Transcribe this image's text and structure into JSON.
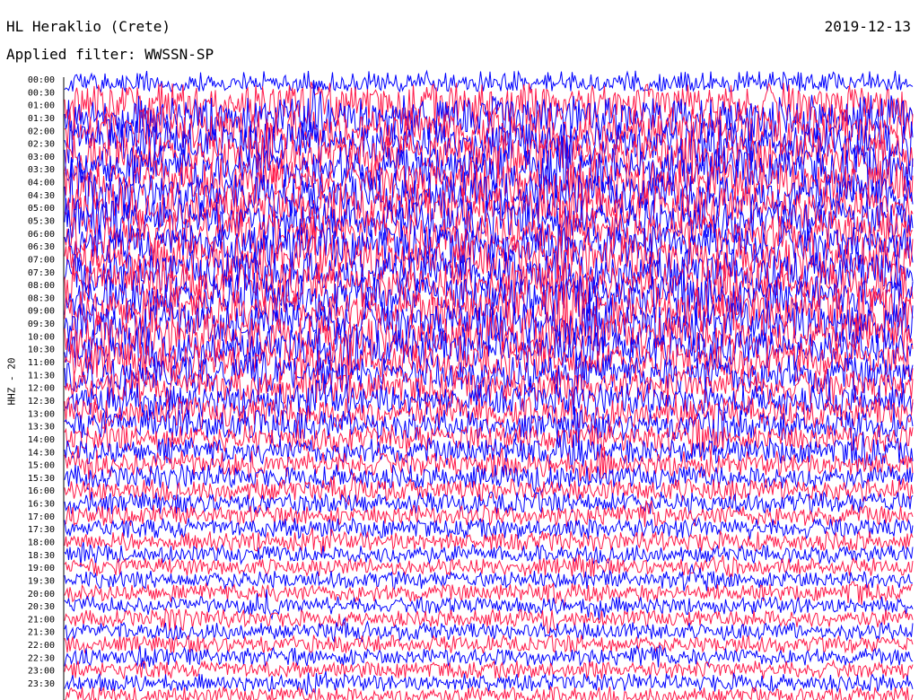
{
  "header": {
    "station": "HL Heraklio (Crete)",
    "date": "2019-12-13",
    "filter_label": "Applied filter: WWSSN-SP"
  },
  "chart_data": {
    "type": "helicorder",
    "channel_label": "HHZ - 20",
    "line_labels": [
      "00:00",
      "00:30",
      "01:00",
      "01:30",
      "02:00",
      "02:30",
      "03:00",
      "03:30",
      "04:00",
      "04:30",
      "05:00",
      "05:30",
      "06:00",
      "06:30",
      "07:00",
      "07:30",
      "08:00",
      "08:30",
      "09:00",
      "09:30",
      "10:00",
      "10:30",
      "11:00",
      "11:30",
      "12:00",
      "12:30",
      "13:00",
      "13:30",
      "14:00",
      "14:30",
      "15:00",
      "15:30",
      "16:00",
      "16:30",
      "17:00",
      "17:30",
      "18:00",
      "18:30",
      "19:00",
      "19:30",
      "20:00",
      "20:30",
      "21:00",
      "21:30",
      "22:00",
      "22:30",
      "23:00",
      "23:30"
    ],
    "line_colors": [
      "#0000ff",
      "#ff1a4a"
    ],
    "relative_amplitude": [
      1.0,
      1.0,
      1.0,
      1.0,
      1.0,
      1.0,
      1.0,
      1.0,
      1.0,
      1.0,
      1.0,
      1.0,
      1.0,
      1.0,
      1.0,
      1.0,
      1.0,
      1.0,
      1.0,
      1.0,
      0.95,
      0.9,
      0.85,
      0.8,
      0.75,
      0.72,
      0.7,
      0.65,
      0.6,
      0.58,
      0.55,
      0.52,
      0.5,
      0.48,
      0.46,
      0.44,
      0.42,
      0.4,
      0.4,
      0.4,
      0.4,
      0.4,
      0.4,
      0.4,
      0.4,
      0.4,
      0.4,
      0.4
    ]
  }
}
